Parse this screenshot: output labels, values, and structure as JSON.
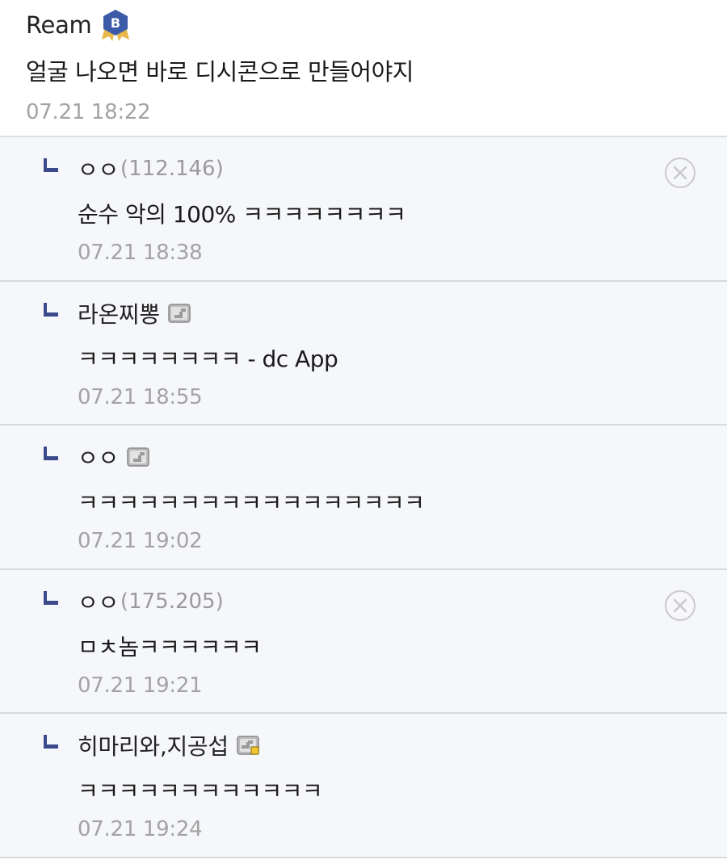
{
  "main_comment": {
    "author": "Ream",
    "badge_letter": "B",
    "text": "얼굴 나오면 바로 디시콘으로 만들어야지",
    "timestamp": "07.21 18:22"
  },
  "replies": [
    {
      "author": "ㅇㅇ",
      "ip": "(112.146)",
      "text": "순수 악의 100% ㅋㅋㅋㅋㅋㅋㅋㅋ",
      "timestamp": "07.21 18:38",
      "has_delete": true,
      "icon": "none"
    },
    {
      "author": "라온찌뽕",
      "ip": "",
      "text": "ㅋㅋㅋㅋㅋㅋㅋㅋ - dc App",
      "timestamp": "07.21 18:55",
      "has_delete": false,
      "icon": "fixed-nick-icon"
    },
    {
      "author": "ㅇㅇ",
      "ip": "",
      "text": "ㅋㅋㅋㅋㅋㅋㅋㅋㅋㅋㅋㅋㅋㅋㅋㅋㅋ",
      "timestamp": "07.21 19:02",
      "has_delete": false,
      "icon": "fixed-nick-icon"
    },
    {
      "author": "ㅇㅇ",
      "ip": "(175.205)",
      "text": "ㅁㅊ놈ㅋㅋㅋㅋㅋㅋ",
      "timestamp": "07.21 19:21",
      "has_delete": true,
      "icon": "none"
    },
    {
      "author": "히마리와,지공섭",
      "ip": "",
      "text": "ㅋㅋㅋㅋㅋㅋㅋㅋㅋㅋㅋㅋ",
      "timestamp": "07.21 19:24",
      "has_delete": false,
      "icon": "semi-fixed-nick-icon"
    }
  ],
  "colors": {
    "badge": "#3b5aa8",
    "badge_ribbon": "#e8b84a",
    "reply_bg": "#f6f7fa",
    "reply_arrow": "#3a4a8a",
    "timestamp": "#a3a3a3"
  }
}
